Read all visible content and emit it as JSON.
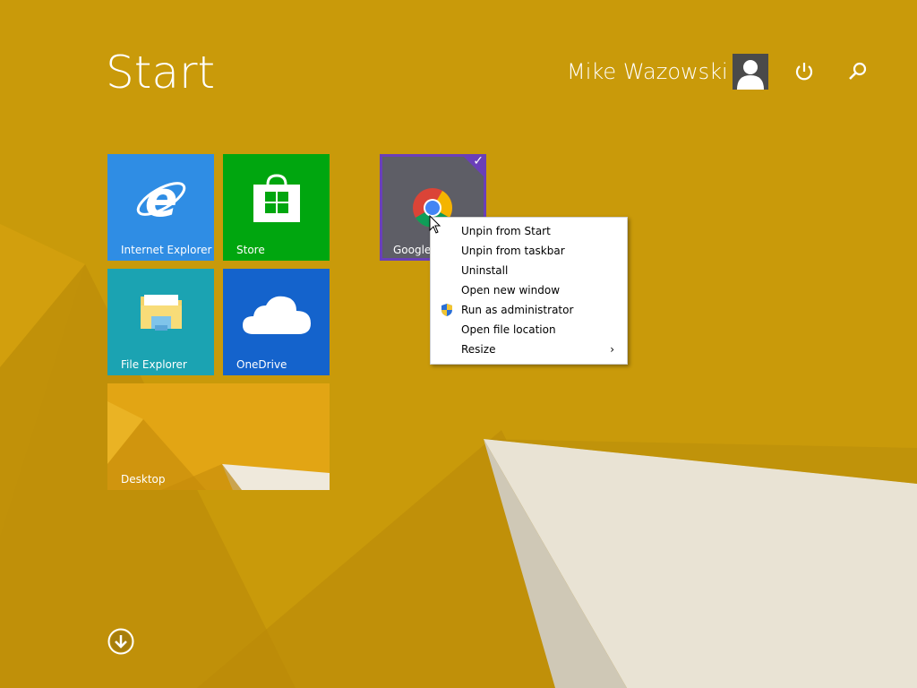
{
  "header": {
    "title": "Start",
    "user_name": "Mike Wazowski",
    "avatar_icon": "user-silhouette-icon",
    "power_icon": "power-icon",
    "search_icon": "search-icon"
  },
  "tiles": [
    {
      "label": "Internet Explorer",
      "icon": "internet-explorer-icon",
      "color": "#2f8de4"
    },
    {
      "label": "Store",
      "icon": "store-icon",
      "color": "#00a60f"
    },
    {
      "label": "Google",
      "icon": "chrome-icon",
      "color": "#5e5e66",
      "selected": true
    },
    {
      "label": "File Explorer",
      "icon": "folder-icon",
      "color": "#1ba3b2"
    },
    {
      "label": "OneDrive",
      "icon": "cloud-icon",
      "color": "#1463cc"
    },
    {
      "label": "Desktop",
      "icon": "desktop-wallpaper",
      "color": "#e2a514"
    }
  ],
  "context_menu": {
    "items": [
      {
        "label": "Unpin from Start"
      },
      {
        "label": "Unpin from taskbar"
      },
      {
        "label": "Uninstall"
      },
      {
        "label": "Open new window"
      },
      {
        "label": "Run as administrator",
        "icon": "uac-shield-icon"
      },
      {
        "label": "Open file location"
      },
      {
        "label": "Resize",
        "submenu": true,
        "arrow": "›"
      }
    ]
  },
  "footer": {
    "all_apps_icon": "down-arrow-circle-icon"
  },
  "colors": {
    "background": "#c99a0a",
    "selection_accent": "#6a3fb8"
  }
}
